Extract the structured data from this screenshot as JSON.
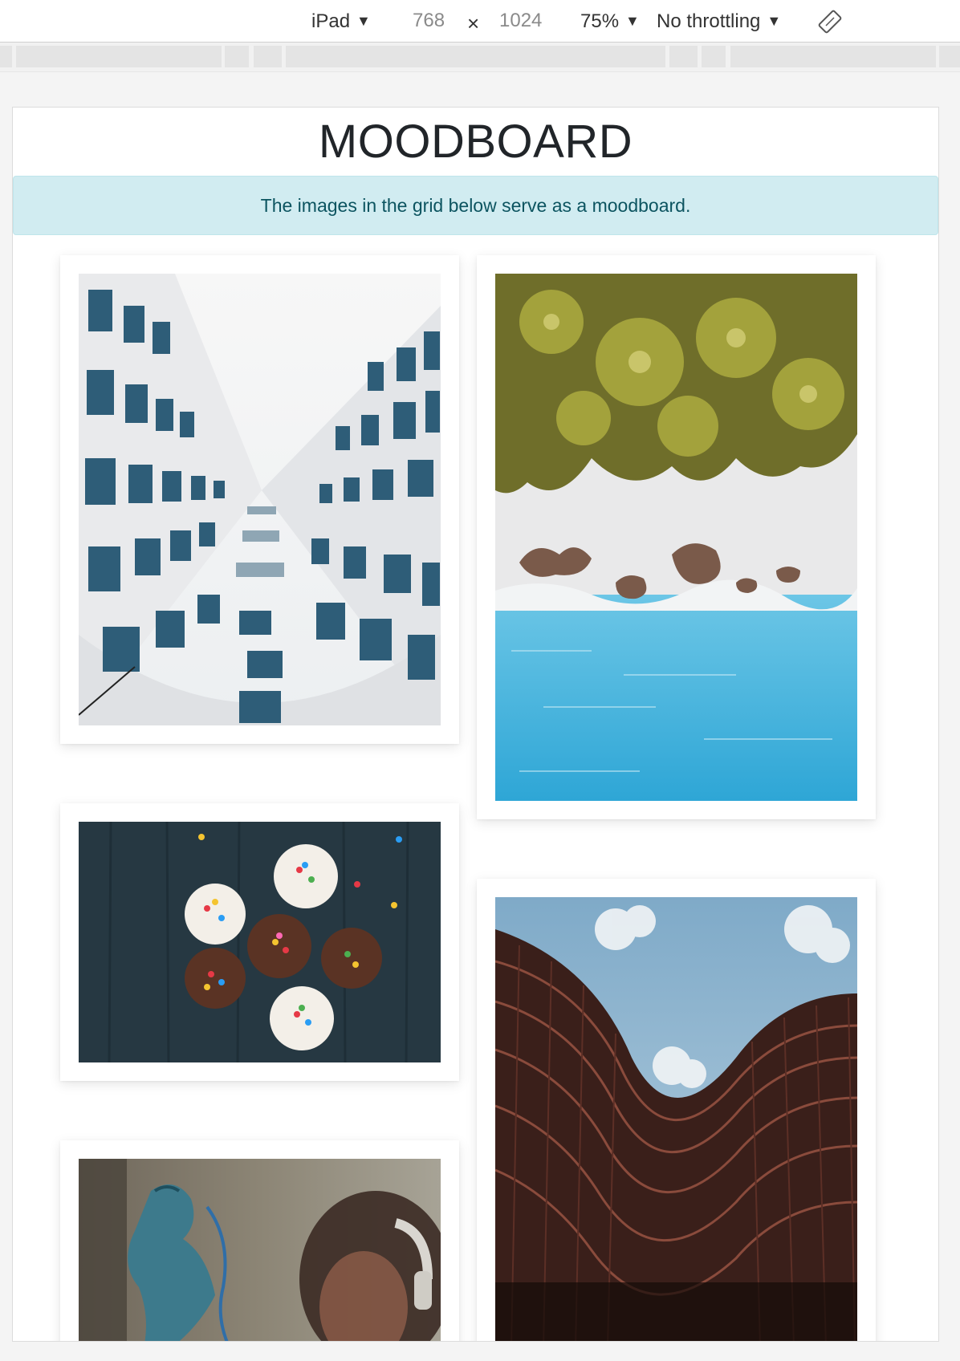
{
  "devtools": {
    "device": "iPad",
    "width": "768",
    "times": "×",
    "height": "1024",
    "zoom": "75%",
    "throttling": "No throttling",
    "caret": "▼"
  },
  "page": {
    "title": "MOODBOARD",
    "alert_text": "The images in the grid below serve as a moodboard."
  },
  "images": [
    {
      "name": "building-windows-photo",
      "subject": "looking up between white buildings"
    },
    {
      "name": "beach-palms-photo",
      "subject": "aerial beach with palms and water"
    },
    {
      "name": "cupcakes-photo",
      "subject": "cupcakes with sprinkles"
    },
    {
      "name": "curved-building-photo",
      "subject": "curved brown building against sky"
    },
    {
      "name": "graffiti-headphones-photo",
      "subject": "graffiti wall and person with headphones"
    }
  ],
  "colors": {
    "alert_bg": "#d1ecf1",
    "alert_text": "#0c5460",
    "water": "#3fb0d8",
    "palm": "#8a8a2e"
  }
}
